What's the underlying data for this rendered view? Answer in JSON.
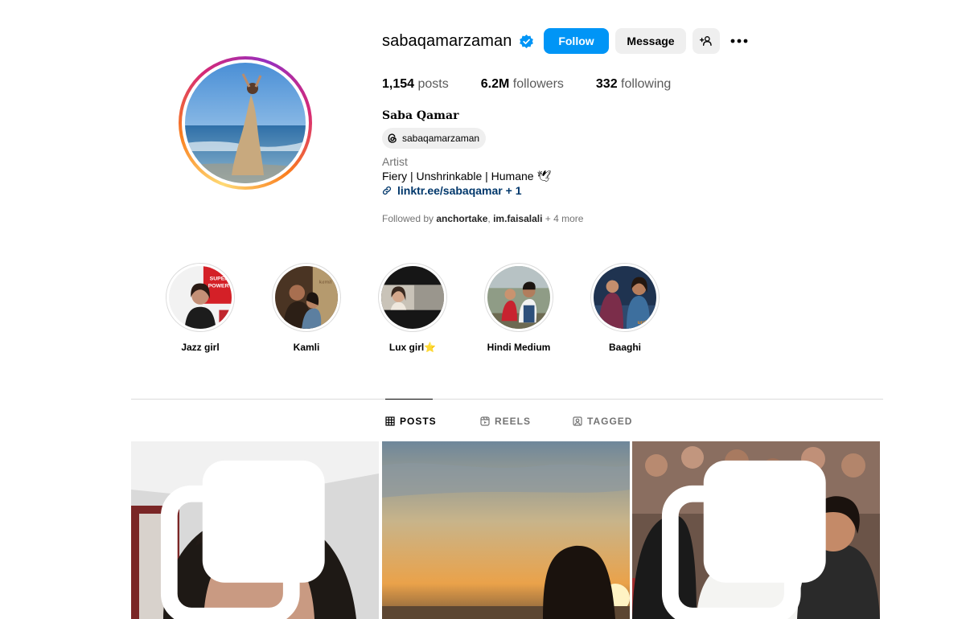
{
  "profile": {
    "username": "sabaqamarzaman",
    "full_name": "Saba Qamar",
    "threads_handle": "sabaqamarzaman",
    "category": "Artist",
    "bio": "Fiery | Unshrinkable | Humane 🕊",
    "link_text": "linktr.ee/sabaqamar",
    "link_more": " + 1",
    "verified_icon": "verified-badge-icon",
    "accent_color": "#0095f6"
  },
  "actions": {
    "follow_label": "Follow",
    "message_label": "Message"
  },
  "stats": {
    "posts_count": "1,154",
    "posts_label": " posts",
    "followers_count": "6.2M",
    "followers_label": " followers",
    "following_count": "332",
    "following_label": " following"
  },
  "followed_by": {
    "prefix": "Followed by ",
    "user1": "anchortake",
    "sep": ", ",
    "user2": "im.faisalali",
    "suffix": " + 4 more"
  },
  "highlights": [
    {
      "label": "Jazz girl"
    },
    {
      "label": "Kamli"
    },
    {
      "label": "Lux girl⭐"
    },
    {
      "label": "Hindi Medium"
    },
    {
      "label": "Baaghi"
    }
  ],
  "tabs": {
    "posts": "POSTS",
    "reels": "REELS",
    "tagged": "TAGGED",
    "active": "posts"
  }
}
